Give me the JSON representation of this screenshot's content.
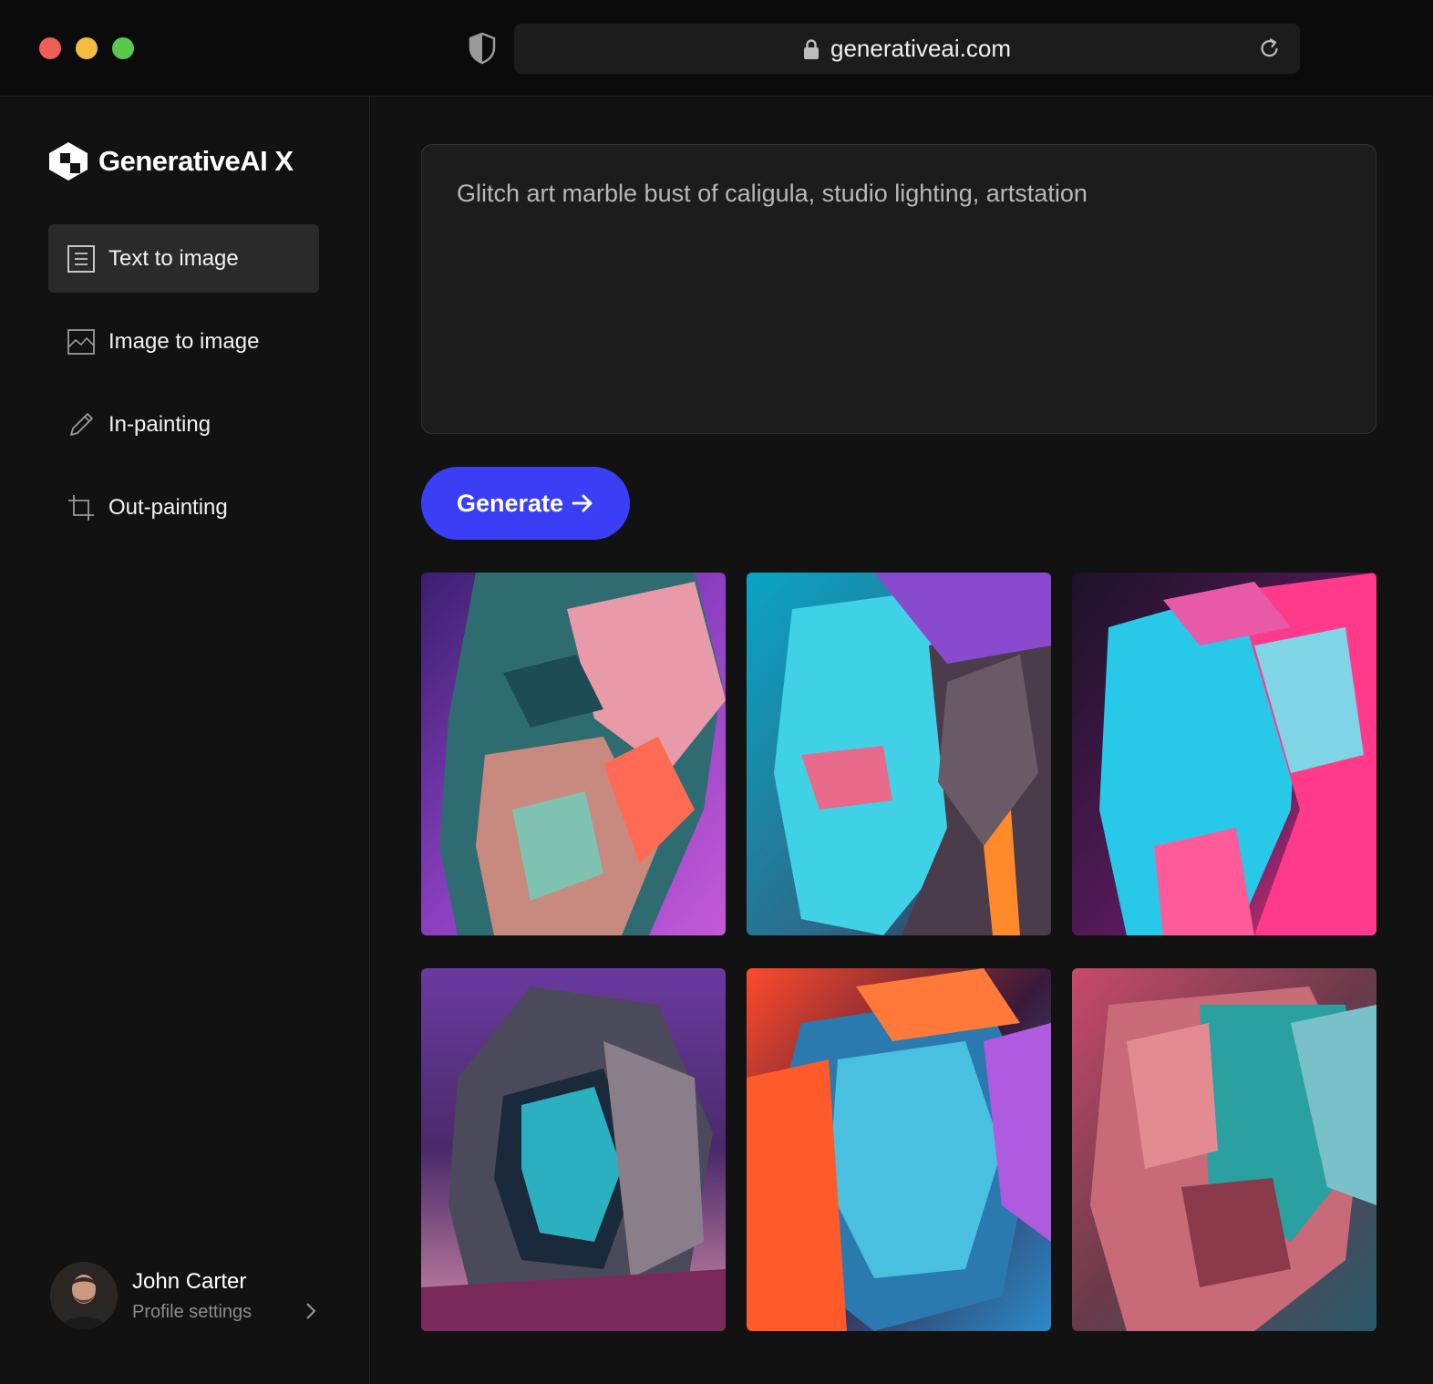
{
  "browser": {
    "url": "generativeai.com"
  },
  "sidebar": {
    "brand": "GenerativeAI X",
    "items": [
      {
        "label": "Text to image",
        "icon": "document-icon",
        "active": true
      },
      {
        "label": "Image to image",
        "icon": "image-icon",
        "active": false
      },
      {
        "label": "In-painting",
        "icon": "pencil-icon",
        "active": false
      },
      {
        "label": "Out-painting",
        "icon": "crop-icon",
        "active": false
      }
    ],
    "profile": {
      "name": "John Carter",
      "subtitle": "Profile settings"
    }
  },
  "main": {
    "prompt": "Glitch art marble bust of caligula, studio lighting, artstation",
    "generate_label": "Generate"
  },
  "colors": {
    "accent": "#3a3ef5",
    "background": "#121212",
    "titlebar": "#0b0b0b"
  }
}
